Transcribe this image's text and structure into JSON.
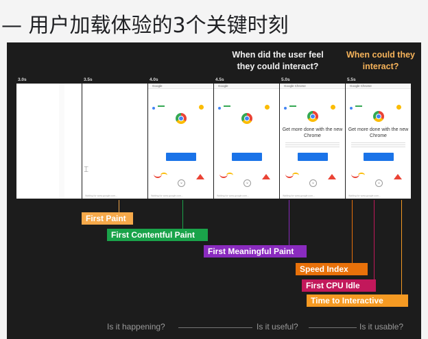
{
  "heading": "— 用户加载体验的3个关键时刻",
  "questions": {
    "q1": "When did the user feel they could interact?",
    "q2": "When could they interact?"
  },
  "colors": {
    "panel_bg": "#1c1c1c",
    "first_paint": "#f6a94a",
    "fcp": "#1aa34a",
    "fmp": "#8a2bbf",
    "speed_index": "#e8710a",
    "cpu_idle": "#c2185b",
    "tti": "#f59a23"
  },
  "frames": [
    {
      "time": "3.0s",
      "state": "blank",
      "header": "",
      "headline": "",
      "footer": ""
    },
    {
      "time": "3.5s",
      "state": "blank",
      "header": "",
      "headline": "",
      "footer": "Waiting for www.google.com..."
    },
    {
      "time": "4.0s",
      "state": "partial",
      "header": "Google",
      "headline": "",
      "footer": "Waiting for www.google.com..."
    },
    {
      "time": "4.5s",
      "state": "partial",
      "header": "Google",
      "headline": "",
      "footer": "Waiting for www.google.com..."
    },
    {
      "time": "5.0s",
      "state": "full",
      "header": "Google Chrome",
      "headline": "Get more done with the new Chrome",
      "footer": "Waiting for www.google.com..."
    },
    {
      "time": "5.5s",
      "state": "full",
      "header": "Google Chrome",
      "headline": "Get more done with the new Chrome",
      "footer": "Waiting for www.google.com..."
    }
  ],
  "metrics": {
    "first_paint": "First Paint",
    "fcp": "First Contentful Paint",
    "fmp": "First Meaningful Paint",
    "speed_index": "Speed Index",
    "cpu_idle": "First CPU Idle",
    "tti": "Time to Interactive"
  },
  "bottom": {
    "happening": "Is it happening?",
    "useful": "Is it useful?",
    "usable": "Is it usable?"
  }
}
